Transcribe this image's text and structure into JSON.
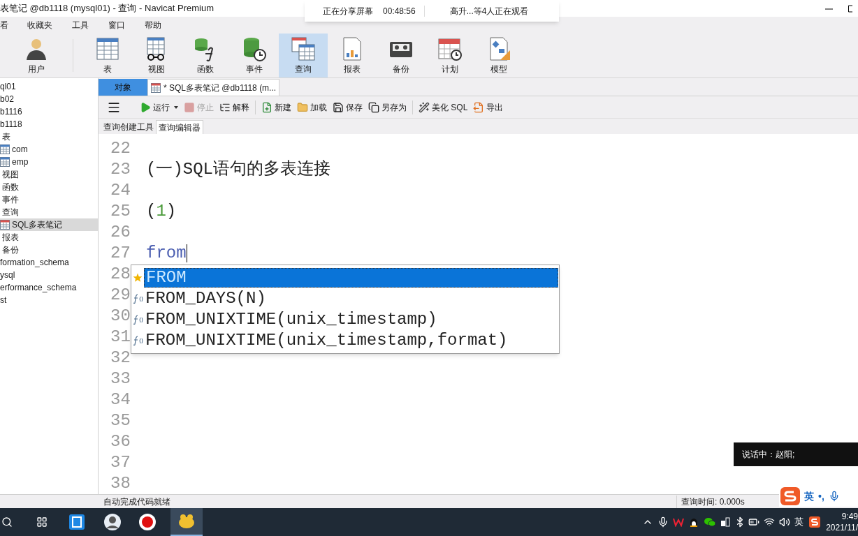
{
  "window": {
    "title": "表笔记 @db1118 (mysql01) - 查询 - Navicat Premium"
  },
  "share_banner": {
    "status": "正在分享屏幕",
    "time": "00:48:56",
    "viewers": "高升...等4人正在观看"
  },
  "menu": [
    "看",
    "收藏夹",
    "工具",
    "窗口",
    "帮助"
  ],
  "toolbar": [
    {
      "label": "用户",
      "kind": "user",
      "selected": false
    },
    {
      "label": "表",
      "kind": "table",
      "selected": false
    },
    {
      "label": "视图",
      "kind": "view",
      "selected": false
    },
    {
      "label": "函数",
      "kind": "function",
      "selected": false
    },
    {
      "label": "事件",
      "kind": "event",
      "selected": false
    },
    {
      "label": "查询",
      "kind": "query",
      "selected": true
    },
    {
      "label": "报表",
      "kind": "report",
      "selected": false
    },
    {
      "label": "备份",
      "kind": "backup",
      "selected": false
    },
    {
      "label": "计划",
      "kind": "schedule",
      "selected": false
    },
    {
      "label": "模型",
      "kind": "model",
      "selected": false
    }
  ],
  "sidebar": {
    "tree": [
      {
        "label": "ql01",
        "selected": false,
        "children": [
          {
            "label": "b02",
            "selected": false
          },
          {
            "label": "b1116",
            "selected": false
          },
          {
            "label": "b1118",
            "selected": false,
            "children": [
              {
                "label": "表",
                "selected": false,
                "children": [
                  {
                    "label": "com",
                    "kind": "table",
                    "selected": false
                  },
                  {
                    "label": "emp",
                    "kind": "table",
                    "selected": false
                  }
                ]
              },
              {
                "label": "视图",
                "selected": false
              },
              {
                "label": "函数",
                "selected": false
              },
              {
                "label": "事件",
                "selected": false
              },
              {
                "label": "查询",
                "selected": false,
                "children": [
                  {
                    "label": "SQL多表笔记",
                    "kind": "query",
                    "selected": true
                  }
                ]
              },
              {
                "label": "报表",
                "selected": false
              },
              {
                "label": "备份",
                "selected": false
              }
            ]
          },
          {
            "label": "formation_schema",
            "selected": false
          },
          {
            "label": "ysql",
            "selected": false
          },
          {
            "label": "erformance_schema",
            "selected": false
          },
          {
            "label": "st",
            "selected": false
          }
        ]
      }
    ]
  },
  "doc_tabs": [
    {
      "label": "对象",
      "selected": true,
      "kind": "plain"
    },
    {
      "label": "* SQL多表笔记 @db1118 (m...",
      "selected": false,
      "kind": "query"
    }
  ],
  "editor_toolbar": [
    {
      "label": "运行",
      "kind": "run",
      "disabled": false
    },
    {
      "label": "停止",
      "kind": "stop",
      "disabled": true
    },
    {
      "label": "解释",
      "kind": "explain",
      "disabled": false
    },
    {
      "label": "新建",
      "kind": "new",
      "disabled": false
    },
    {
      "label": "加载",
      "kind": "load",
      "disabled": false
    },
    {
      "label": "保存",
      "kind": "save",
      "disabled": false
    },
    {
      "label": "另存为",
      "kind": "saveas",
      "disabled": false
    },
    {
      "label": "美化 SQL",
      "kind": "beautify",
      "disabled": false
    },
    {
      "label": "导出",
      "kind": "export",
      "disabled": false
    }
  ],
  "sub_tabs": [
    {
      "label": "查询创建工具",
      "selected": false
    },
    {
      "label": "查询编辑器",
      "selected": true
    }
  ],
  "editor": {
    "lines": [
      {
        "number": "22"
      },
      {
        "number": "23",
        "text": "(一)SQL语句的多表连接",
        "kind": "plain"
      },
      {
        "number": "24"
      },
      {
        "number": "25",
        "text": "(1)",
        "kind": "paren_number"
      },
      {
        "number": "26"
      },
      {
        "number": "27",
        "text": "from",
        "kind": "keyword",
        "cursor": true
      },
      {
        "number": "28"
      },
      {
        "number": "29"
      },
      {
        "number": "30"
      },
      {
        "number": "31"
      },
      {
        "number": "32"
      },
      {
        "number": "33"
      },
      {
        "number": "34"
      },
      {
        "number": "35"
      },
      {
        "number": "36"
      },
      {
        "number": "37"
      },
      {
        "number": "38"
      }
    ],
    "autocomplete": [
      {
        "label": "FROM",
        "kind": "keyword",
        "selected": true
      },
      {
        "label": "FROM_DAYS(N)",
        "kind": "function",
        "selected": false
      },
      {
        "label": "FROM_UNIXTIME(unix_timestamp)",
        "kind": "function",
        "selected": false
      },
      {
        "label": "FROM_UNIXTIME(unix_timestamp,format)",
        "kind": "function",
        "selected": false
      }
    ]
  },
  "speaker_notice": "说话中：赵阳;",
  "status_bar": {
    "message": "自动完成代码就绪",
    "query_time": "查询时间: 0.000s"
  },
  "ime_bar": {
    "language": "英",
    "punct": "•,"
  },
  "taskbar": {
    "language": "英",
    "time": "9:49",
    "date": "2021/11/"
  }
}
